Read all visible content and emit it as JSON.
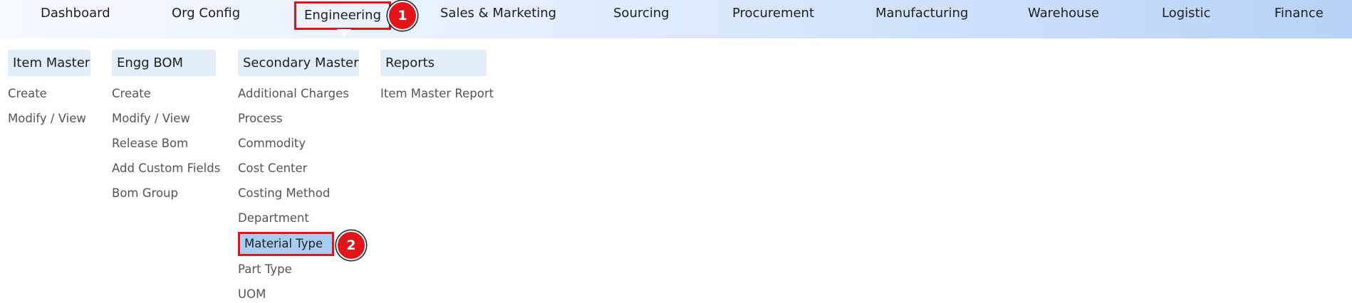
{
  "nav": {
    "items": [
      {
        "label": "Dashboard"
      },
      {
        "label": "Org Config"
      },
      {
        "label": "Engineering"
      },
      {
        "label": "Sales & Marketing"
      },
      {
        "label": "Sourcing"
      },
      {
        "label": "Procurement"
      },
      {
        "label": "Manufacturing"
      },
      {
        "label": "Warehouse"
      },
      {
        "label": "Logistic"
      },
      {
        "label": "Finance"
      }
    ],
    "active": "Engineering"
  },
  "markers": {
    "step1": "1",
    "step2": "2"
  },
  "menu": {
    "columns": [
      {
        "header": "Item Master",
        "items": [
          "Create",
          "Modify / View"
        ]
      },
      {
        "header": "Engg BOM",
        "items": [
          "Create",
          "Modify / View",
          "Release Bom",
          "Add Custom Fields",
          "Bom Group"
        ]
      },
      {
        "header": "Secondary Master",
        "items": [
          "Additional Charges",
          "Process",
          "Commodity",
          "Cost Center",
          "Costing Method",
          "Department",
          "Material Type",
          "Part Type",
          "UOM"
        ]
      },
      {
        "header": "Reports",
        "items": [
          "Item Master Report"
        ]
      }
    ],
    "selected_item": "Material Type"
  },
  "colors": {
    "highlight_border": "#e2141b",
    "selected_bg": "#a9cdf2",
    "header_bg": "#e4eefb"
  }
}
